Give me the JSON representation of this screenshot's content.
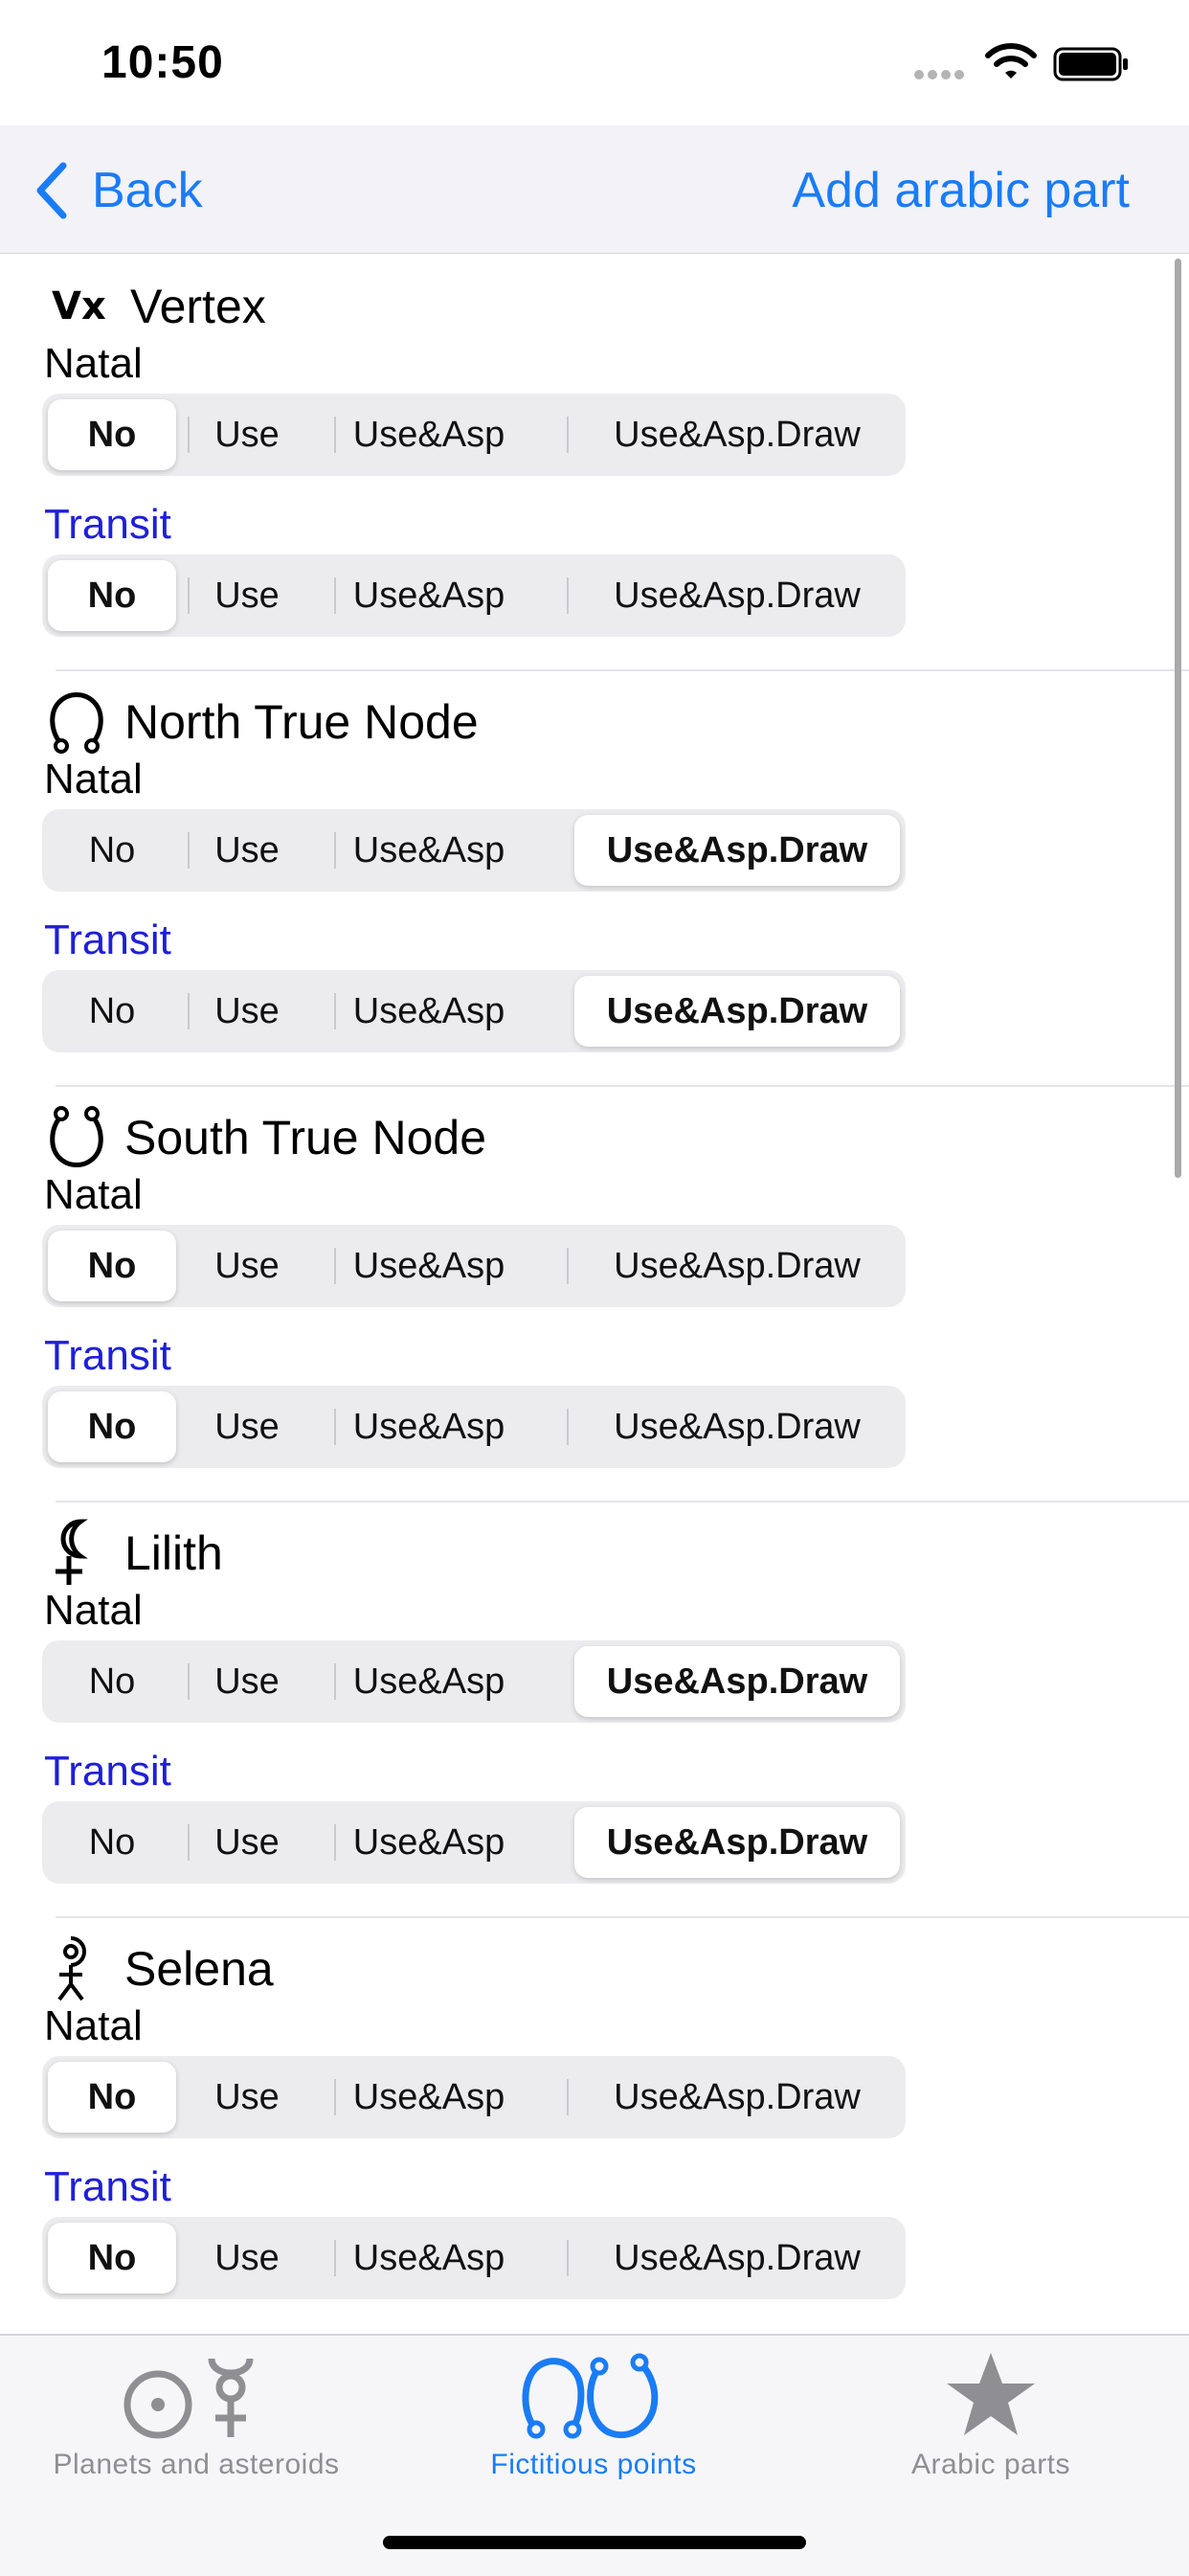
{
  "status_bar": {
    "time": "10:50"
  },
  "nav": {
    "back_label": "Back",
    "action_label": "Add arabic part"
  },
  "labels": {
    "natal": "Natal",
    "transit": "Transit"
  },
  "options": [
    "No",
    "Use",
    "Use&Asp",
    "Use&Asp.Draw"
  ],
  "items": [
    {
      "name": "Vertex",
      "icon": "vertex-icon",
      "icon_text": "Vx",
      "natal": "No",
      "transit": "No"
    },
    {
      "name": "North True Node",
      "icon": "north-node-icon",
      "natal": "Use&Asp.Draw",
      "transit": "Use&Asp.Draw"
    },
    {
      "name": "South True Node",
      "icon": "south-node-icon",
      "natal": "No",
      "transit": "No"
    },
    {
      "name": "Lilith",
      "icon": "lilith-icon",
      "natal": "Use&Asp.Draw",
      "transit": "Use&Asp.Draw"
    },
    {
      "name": "Selena",
      "icon": "selena-icon",
      "natal": "No",
      "transit": "No"
    }
  ],
  "tabs": [
    {
      "label": "Planets and asteroids",
      "icon": "planets-icon",
      "active": false
    },
    {
      "label": "Fictitious points",
      "icon": "fictitious-points-icon",
      "active": true
    },
    {
      "label": "Arabic parts",
      "icon": "star-icon",
      "active": false
    }
  ],
  "colors": {
    "accent": "#1a7cf5",
    "transit_label": "#1f1fd9",
    "inactive_tab": "#8e8e93"
  }
}
